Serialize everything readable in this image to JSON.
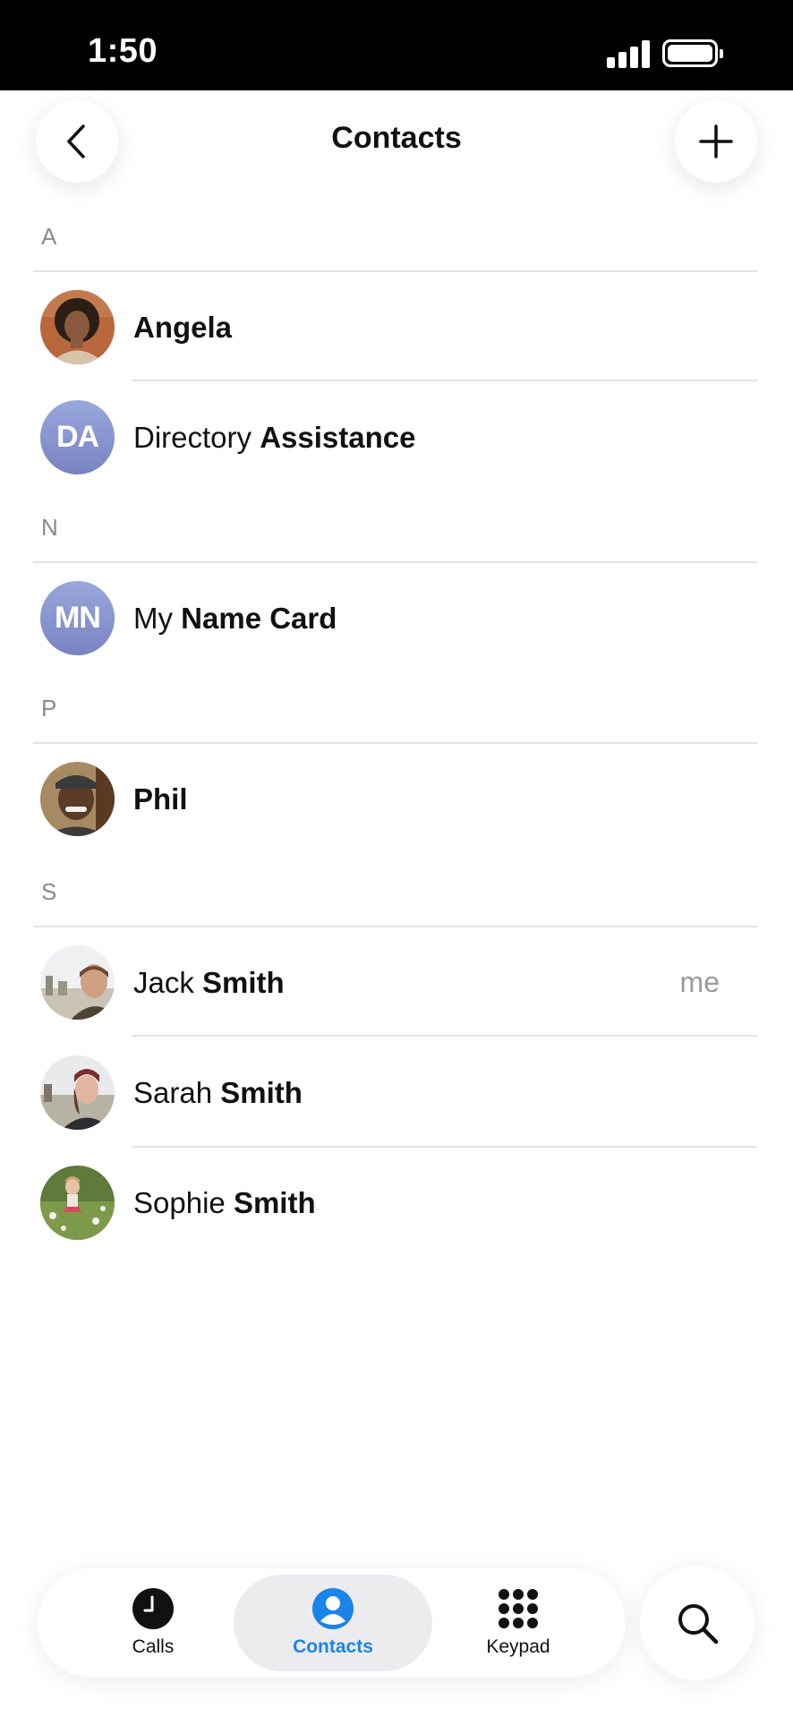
{
  "status_bar": {
    "time": "1:50"
  },
  "header": {
    "title": "Contacts"
  },
  "sections": [
    {
      "letter": "A",
      "contacts": [
        {
          "first": "",
          "last": "Angela",
          "type": "photo",
          "photo": "angela"
        },
        {
          "first": "Directory ",
          "last": "Assistance",
          "type": "initials",
          "initials": "DA"
        }
      ]
    },
    {
      "letter": "N",
      "contacts": [
        {
          "first": "My ",
          "last": "Name Card",
          "type": "initials",
          "initials": "MN"
        }
      ]
    },
    {
      "letter": "P",
      "contacts": [
        {
          "first": "",
          "last": "Phil",
          "type": "photo",
          "photo": "phil"
        }
      ]
    },
    {
      "letter": "S",
      "contacts": [
        {
          "first": "Jack ",
          "last": "Smith",
          "type": "photo",
          "photo": "jack",
          "tag": "me"
        },
        {
          "first": "Sarah ",
          "last": "Smith",
          "type": "photo",
          "photo": "sarah"
        },
        {
          "first": "Sophie ",
          "last": "Smith",
          "type": "photo",
          "photo": "sophie"
        }
      ]
    }
  ],
  "tabbar": {
    "tabs": [
      {
        "label": "Calls",
        "icon": "clock-icon"
      },
      {
        "label": "Contacts",
        "icon": "person-icon",
        "active": true
      },
      {
        "label": "Keypad",
        "icon": "keypad-icon"
      }
    ],
    "search_icon": "search-icon"
  },
  "colors": {
    "accent": "#1a84e8",
    "initials_avatar": "#8a94cf",
    "active_tab_bg": "#ececee"
  }
}
